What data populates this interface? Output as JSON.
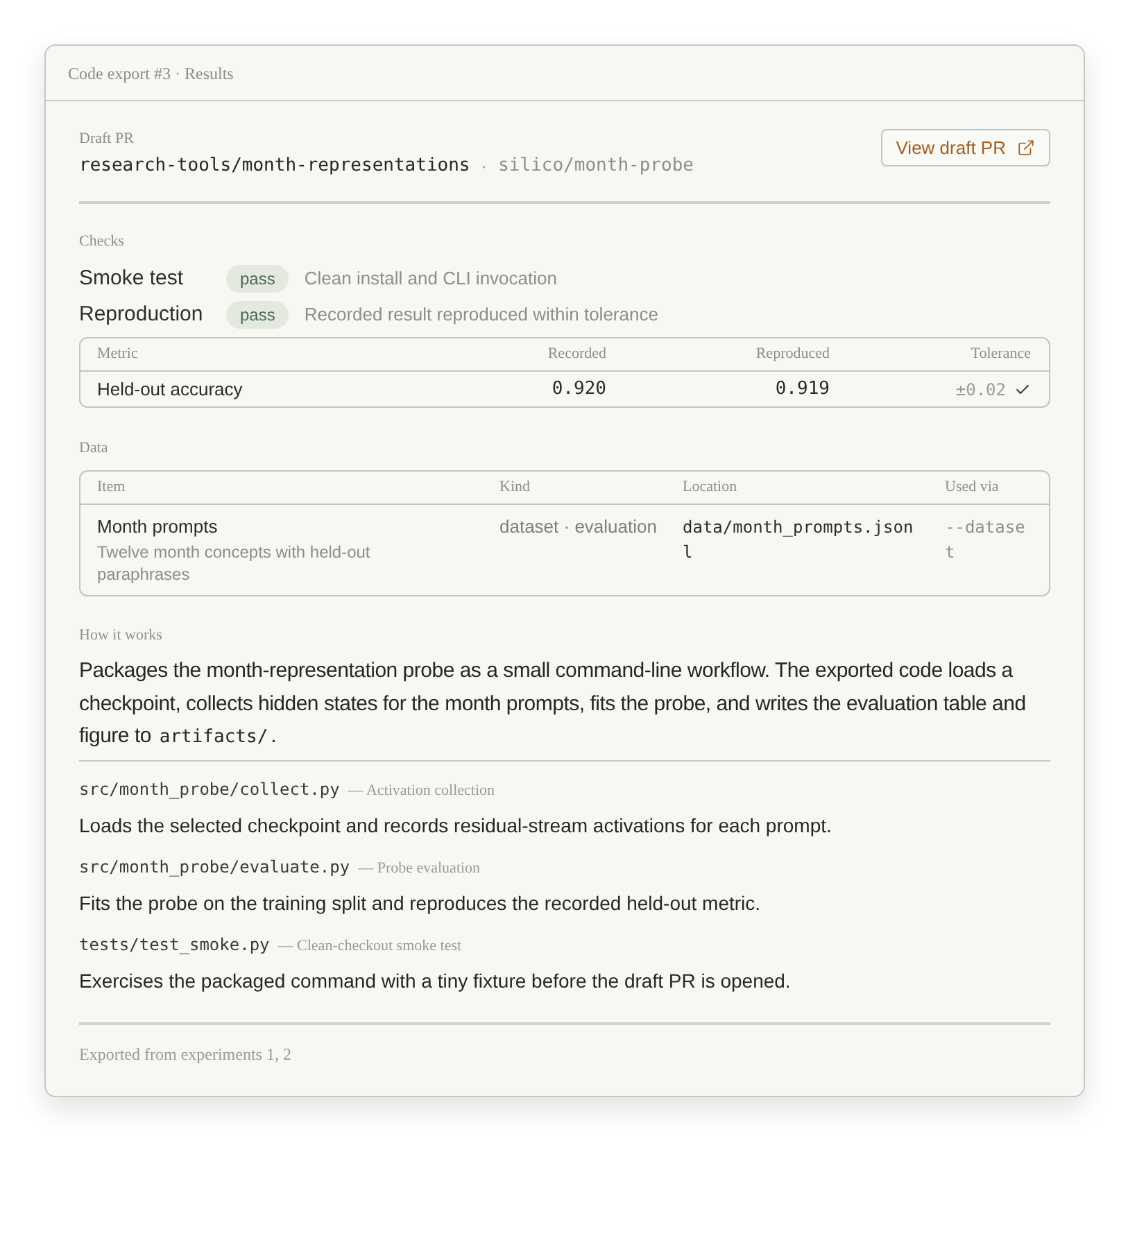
{
  "header": {
    "title": "Code export #3 · Results"
  },
  "draft_pr": {
    "label": "Draft PR",
    "repo": "research-tools/month-representations",
    "separator": "·",
    "branch": "silico/month-probe",
    "button": "View draft PR"
  },
  "checks": {
    "label": "Checks",
    "items": [
      {
        "name": "Smoke test",
        "status": "pass",
        "description": "Clean install and CLI invocation"
      },
      {
        "name": "Reproduction",
        "status": "pass",
        "description": "Recorded result reproduced within tolerance"
      }
    ],
    "metrics": {
      "columns": [
        "Metric",
        "Recorded",
        "Reproduced",
        "Tolerance"
      ],
      "rows": [
        {
          "metric": "Held-out accuracy",
          "recorded": "0.920",
          "reproduced": "0.919",
          "tolerance": "±0.02",
          "within_tolerance": true
        }
      ]
    }
  },
  "data": {
    "label": "Data",
    "columns": [
      "Item",
      "Kind",
      "Location",
      "Used via"
    ],
    "rows": [
      {
        "name": "Month prompts",
        "description": "Twelve month concepts with held-out paraphrases",
        "kind": "dataset · evaluation",
        "location": "data/month_prompts.jsonl",
        "used_via": "--dataset"
      }
    ]
  },
  "how_it_works": {
    "label": "How it works",
    "text": "Packages the month-representation probe as a small command-line workflow. The exported code loads a checkpoint, collects hidden states for the month prompts, fits the probe, and writes the evaluation table and figure to",
    "code": "artifacts/",
    "text_after": ".",
    "files": [
      {
        "path": "src/month_probe/collect.py",
        "note": "— Activation collection",
        "description": "Loads the selected checkpoint and records residual-stream activations for each prompt."
      },
      {
        "path": "src/month_probe/evaluate.py",
        "note": "— Probe evaluation",
        "description": "Fits the probe on the training split and reproduces the recorded held-out metric."
      },
      {
        "path": "tests/test_smoke.py",
        "note": "— Clean-checkout smoke test",
        "description": "Exercises the packaged command with a tiny fixture before the draft PR is opened."
      }
    ]
  },
  "footer": {
    "text": "Exported from experiments 1, 2"
  }
}
